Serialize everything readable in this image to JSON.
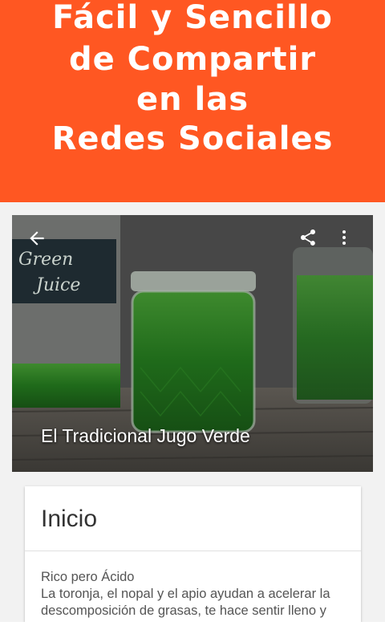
{
  "promo": {
    "lines": [
      "Fácil y Sencillo",
      "de Compartir",
      "en las",
      "Redes Sociales"
    ],
    "background_color": "#ff5722"
  },
  "app_bar": {
    "back_icon": "arrow-left-icon",
    "share_icon": "share-icon",
    "overflow_icon": "more-vert-icon"
  },
  "hero": {
    "title": "El Tradicional Jugo Verde",
    "jar_label": "Green Juice"
  },
  "card": {
    "title": "Inicio",
    "subtitle": "Rico pero Ácido",
    "body": "La toronja, el nopal y el apio ayudan a acelerar la descomposición de grasas, te hace sentir lleno y"
  }
}
